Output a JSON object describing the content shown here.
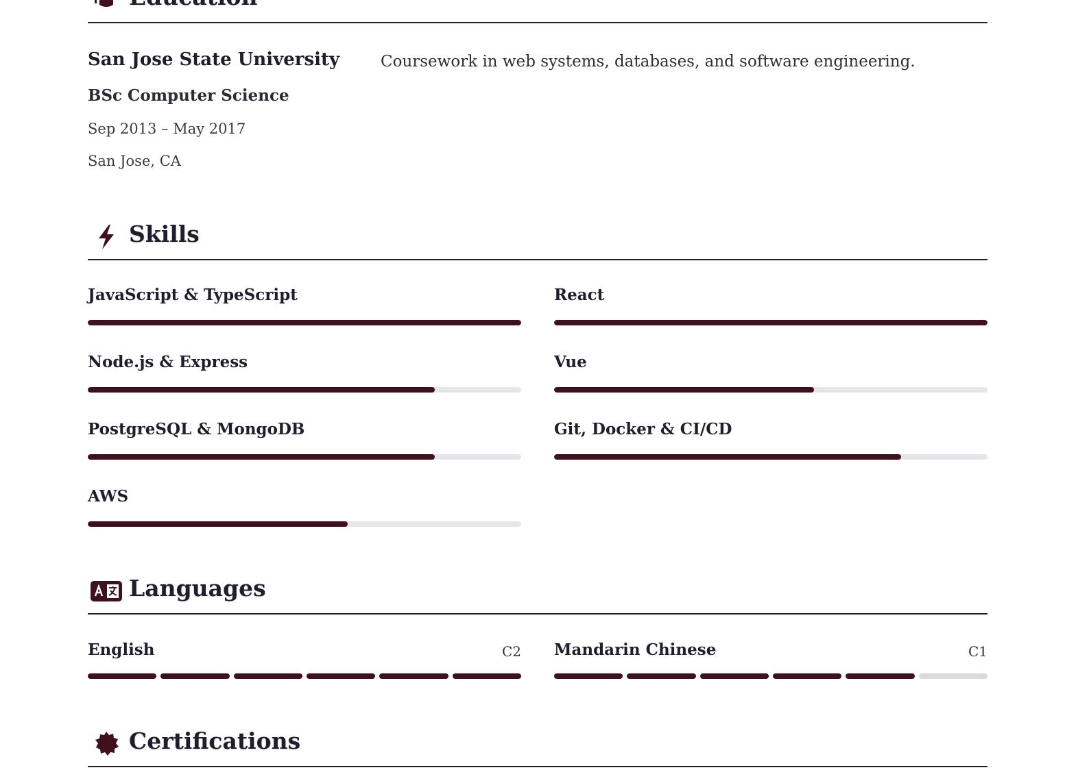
{
  "sections": {
    "education": {
      "title": "Education",
      "icon": "graduation-cap-icon"
    },
    "skills": {
      "title": "Skills",
      "icon": "lightning-bolt-icon"
    },
    "languages": {
      "title": "Languages",
      "icon": "translate-icon"
    },
    "certifications": {
      "title": "Certifications",
      "icon": "certificate-badge-icon"
    }
  },
  "education": {
    "school": "San Jose State University",
    "degree": "BSc Computer Science",
    "dates": "Sep 2013 – May 2017",
    "location": "San Jose, CA",
    "description": "Coursework in web systems, databases, and software engineering."
  },
  "skills": [
    {
      "name": "JavaScript & TypeScript",
      "level": 1.0
    },
    {
      "name": "React",
      "level": 1.0
    },
    {
      "name": "Node.js & Express",
      "level": 0.8
    },
    {
      "name": "Vue",
      "level": 0.6
    },
    {
      "name": "PostgreSQL & MongoDB",
      "level": 0.8
    },
    {
      "name": "Git, Docker & CI/CD",
      "level": 0.8
    },
    {
      "name": "AWS",
      "level": 0.6
    }
  ],
  "languages": [
    {
      "name": "English",
      "level": "C2",
      "filled": 6,
      "total": 6
    },
    {
      "name": "Mandarin Chinese",
      "level": "C1",
      "filled": 5,
      "total": 6
    }
  ],
  "colors": {
    "accent": "#3e111c",
    "track": "#e6e6ea",
    "rule": "#2a1a22"
  }
}
